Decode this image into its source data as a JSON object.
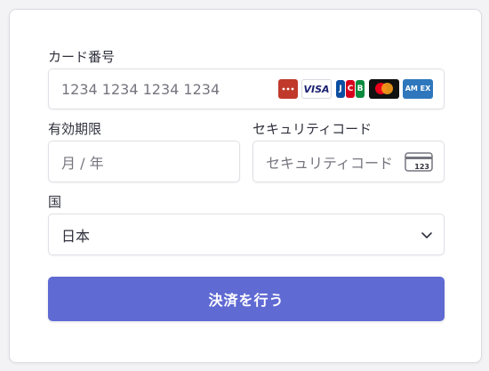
{
  "form": {
    "card_number": {
      "label": "カード番号",
      "placeholder": "1234 1234 1234 1234",
      "brands": [
        "generic-card-icon",
        "visa-icon",
        "jcb-icon",
        "mastercard-icon",
        "amex-icon"
      ],
      "brand_texts": {
        "visa": "VISA",
        "jcb": [
          "J",
          "C",
          "B"
        ],
        "amex": "AM EX"
      }
    },
    "expiry": {
      "label": "有効期限",
      "placeholder": "月 / 年"
    },
    "cvc": {
      "label": "セキュリティコード",
      "placeholder": "セキュリティコード",
      "icon_text": "123"
    },
    "country": {
      "label": "国",
      "value": "日本"
    },
    "submit_label": "決済を行う"
  },
  "colors": {
    "accent": "#5f6ad3",
    "text": "#30313d",
    "placeholder": "#75757f",
    "border": "#e0e0e6"
  }
}
